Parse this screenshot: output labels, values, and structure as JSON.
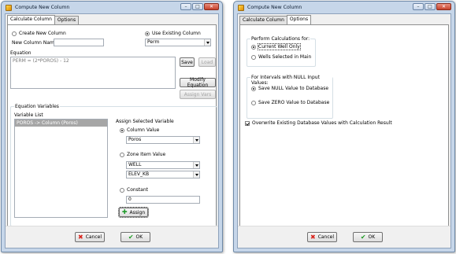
{
  "left_window": {
    "title": "Compute New Column",
    "tabs": [
      "Calculate Column",
      "Options"
    ],
    "create_new_column_label": "Create New Column",
    "use_existing_column_label": "Use Existing Column",
    "new_column_name_label": "New Column Name",
    "new_column_name_value": "",
    "existing_column_value": "Perm",
    "equation_label": "Equation",
    "equation_value": "PERM = (2*POROS) - 12",
    "save_label": "Save",
    "load_label": "Load",
    "modify_equation_label": "Modify Equation",
    "assign_vars_label": "Assign Vars",
    "equation_variables_title": "Equation Variables",
    "variable_list_label": "Variable List",
    "variable_list_items": [
      "POROS -> Column (Poros)"
    ],
    "assign_selected_variable_label": "Assign Selected Variable",
    "column_value_label": "Column Value",
    "column_value_selected": "Poros",
    "zone_item_value_label": "Zone Item Value",
    "zone_value_1": "WELL",
    "zone_value_2": "ELEV_KB",
    "constant_label": "Constant",
    "constant_value": "0",
    "assign_label": "Assign",
    "cancel_label": "Cancel",
    "ok_label": "OK"
  },
  "right_window": {
    "title": "Compute New Column",
    "tabs": [
      "Calculate Column",
      "Options"
    ],
    "perform_calculations_title": "Perform Calculations for:",
    "current_well_only_label": "Current Well Only",
    "wells_selected_label": "Wells Selected in Main",
    "null_intervals_title": "For Intervals with NULL Input Values:",
    "save_null_label": "Save NULL Value to Database",
    "save_zero_label": "Save ZERO Value to Database",
    "overwrite_label": "Overwrite Existing Database Values with Calculation Result",
    "cancel_label": "Cancel",
    "ok_label": "OK"
  },
  "icons": {
    "window_icon": "calculator-app-icon",
    "cancel_icon": "red-x-icon",
    "ok_icon": "green-check-icon",
    "assign_icon": "green-plus-icon"
  },
  "colors": {
    "frame": "#c6d6e9",
    "close_button": "#c6412b",
    "list_selection": "#a6a6a6"
  }
}
